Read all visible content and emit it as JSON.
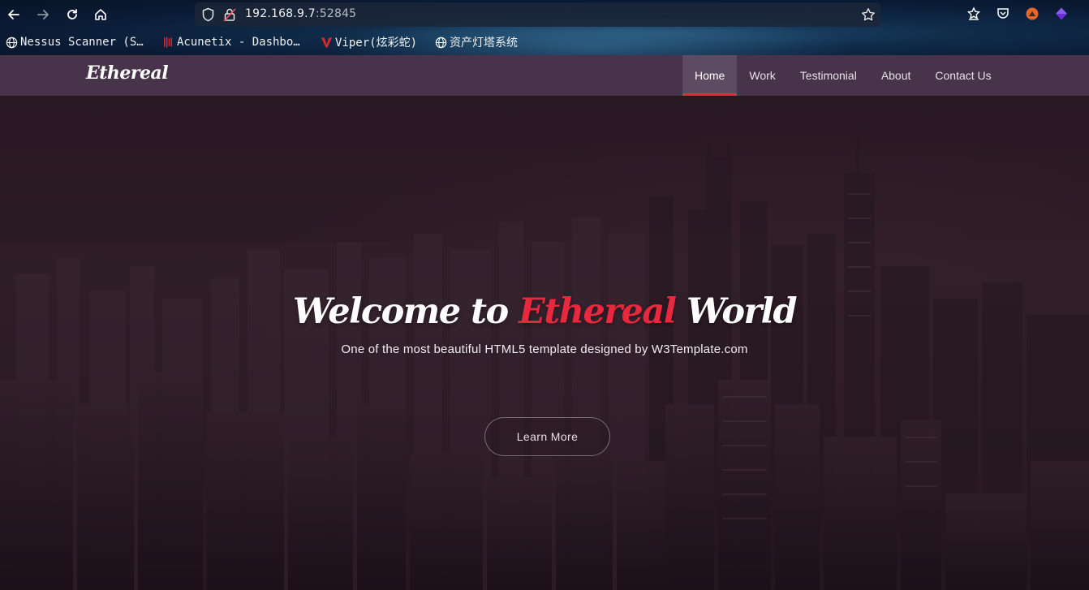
{
  "browser": {
    "url_host": "192.168.9.7",
    "url_port": ":52845",
    "bookmarks": [
      {
        "label": "Nessus Scanner (S…",
        "icon": "globe-icon"
      },
      {
        "label": "Acunetix - Dashbo…",
        "icon": "acunetix-icon"
      },
      {
        "label": "Viper(炫彩蛇)",
        "icon": "viper-icon"
      },
      {
        "label": "资产灯塔系统",
        "icon": "globe-icon"
      }
    ]
  },
  "site": {
    "logo": "Ethereal",
    "nav": [
      {
        "label": "Home",
        "active": true
      },
      {
        "label": "Work",
        "active": false
      },
      {
        "label": "Testimonial",
        "active": false
      },
      {
        "label": "About",
        "active": false
      },
      {
        "label": "Contact Us",
        "active": false
      }
    ],
    "hero": {
      "title_before": "Welcome to ",
      "title_accent": "Ethereal",
      "title_after": " World",
      "subtitle": "One of the most beautiful HTML5 template designed by W3Template.com",
      "button": "Learn More"
    }
  },
  "colors": {
    "accent": "#e8283c",
    "navbar": "#4b374e",
    "active_nav": "#5d4b61"
  }
}
